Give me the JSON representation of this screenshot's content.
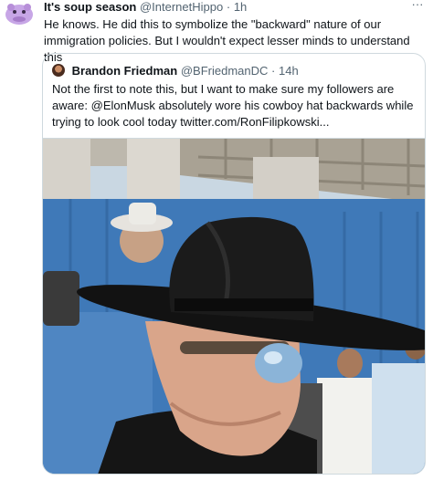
{
  "tweet": {
    "author_name": "It's soup season",
    "author_handle": "@InternetHippo",
    "time": "1h",
    "more_icon": "more-dots-icon",
    "text": "He knows. He did this to symbolize the \"backward\" nature of our immigration policies. But I wouldn't expect lesser minds to understand this"
  },
  "quoted": {
    "author_name": "Brandon Friedman",
    "author_handle": "@BFriedmanDC",
    "time": "14h",
    "text": "Not the first to note this, but I want to make sure my followers are aware: @ElonMusk absolutely wore his cowboy hat backwards while trying to look cool today  twitter.com/RonFilipkowski...",
    "media_caption_icon": "video-frame"
  },
  "colors": {
    "handle": "#536471",
    "border": "#cfd9de",
    "avatar": "#c7a6e6"
  }
}
